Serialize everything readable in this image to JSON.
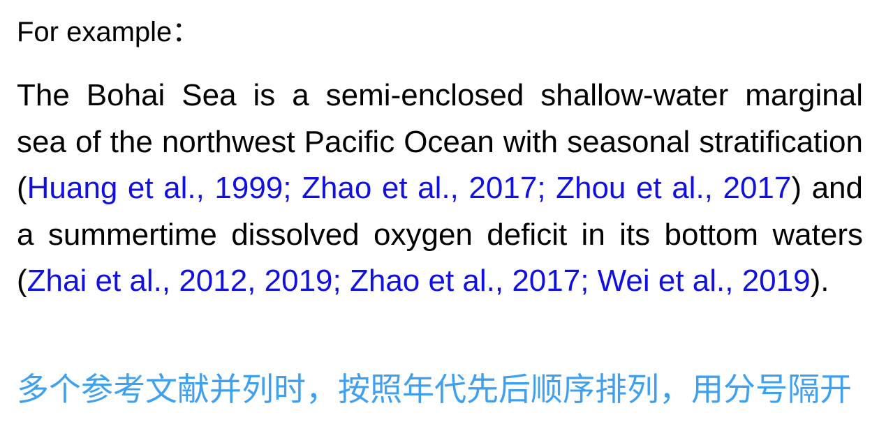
{
  "heading": "For example：",
  "paragraph": {
    "t1": "The Bohai Sea is a semi-enclosed shallow-water marginal sea of the northwest Pacific Ocean with seasonal stratification  (",
    "c1": "Huang et al., 1999; Zhao et al., 2017; Zhou et al., 2017",
    "t2": ") and a summertime dissolved oxygen deficit in its bottom waters (",
    "c2": "Zhai et al., 2012, 2019; Zhao et al., 2017; Wei et al., 2019",
    "t3": ")."
  },
  "note": "多个参考文献并列时，按照年代先后顺序排列，用分号隔开",
  "colors": {
    "citation": "#1010e0",
    "note": "#3ea0ef",
    "text": "#000000"
  }
}
